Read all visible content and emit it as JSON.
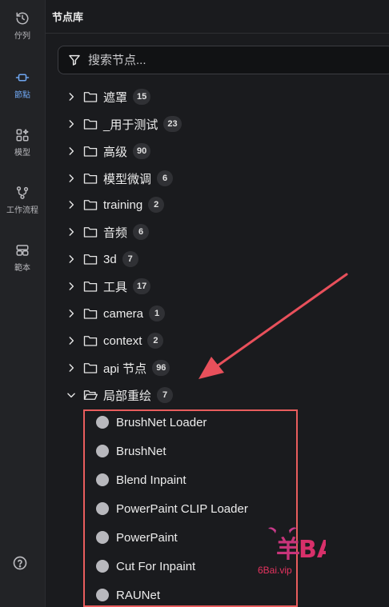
{
  "rail": {
    "items": [
      {
        "label": "佇列",
        "icon": "history-icon",
        "active": false
      },
      {
        "label": "節點",
        "icon": "node-icon",
        "active": true
      },
      {
        "label": "模型",
        "icon": "model-icon",
        "active": false
      },
      {
        "label": "工作流程",
        "icon": "workflow-icon",
        "active": false
      },
      {
        "label": "範本",
        "icon": "template-icon",
        "active": false
      }
    ],
    "help_icon": "help-icon"
  },
  "panel": {
    "title": "节点库",
    "search": {
      "placeholder": "搜索节点...",
      "value": ""
    }
  },
  "folders": [
    {
      "name": "遮罩",
      "count": "15",
      "expanded": false
    },
    {
      "name": "_用于测试",
      "count": "23",
      "expanded": false
    },
    {
      "name": "高级",
      "count": "90",
      "expanded": false
    },
    {
      "name": "模型微调",
      "count": "6",
      "expanded": false
    },
    {
      "name": "training",
      "count": "2",
      "expanded": false
    },
    {
      "name": "音频",
      "count": "6",
      "expanded": false
    },
    {
      "name": "3d",
      "count": "7",
      "expanded": false
    },
    {
      "name": "工具",
      "count": "17",
      "expanded": false
    },
    {
      "name": "camera",
      "count": "1",
      "expanded": false
    },
    {
      "name": "context",
      "count": "2",
      "expanded": false
    },
    {
      "name": "api 节点",
      "count": "96",
      "expanded": false
    },
    {
      "name": "局部重绘",
      "count": "7",
      "expanded": true
    }
  ],
  "nodes": [
    {
      "name": "BrushNet Loader"
    },
    {
      "name": "BrushNet"
    },
    {
      "name": "Blend Inpaint"
    },
    {
      "name": "PowerPaint CLIP Loader"
    },
    {
      "name": "PowerPaint"
    },
    {
      "name": "Cut For Inpaint"
    },
    {
      "name": "RAUNet"
    }
  ],
  "annotation": {
    "highlight_color": "#e85d5d",
    "arrow_color": "#e8505b"
  },
  "watermark": {
    "logo": "羊BAi",
    "text": "6Bai.vip"
  }
}
